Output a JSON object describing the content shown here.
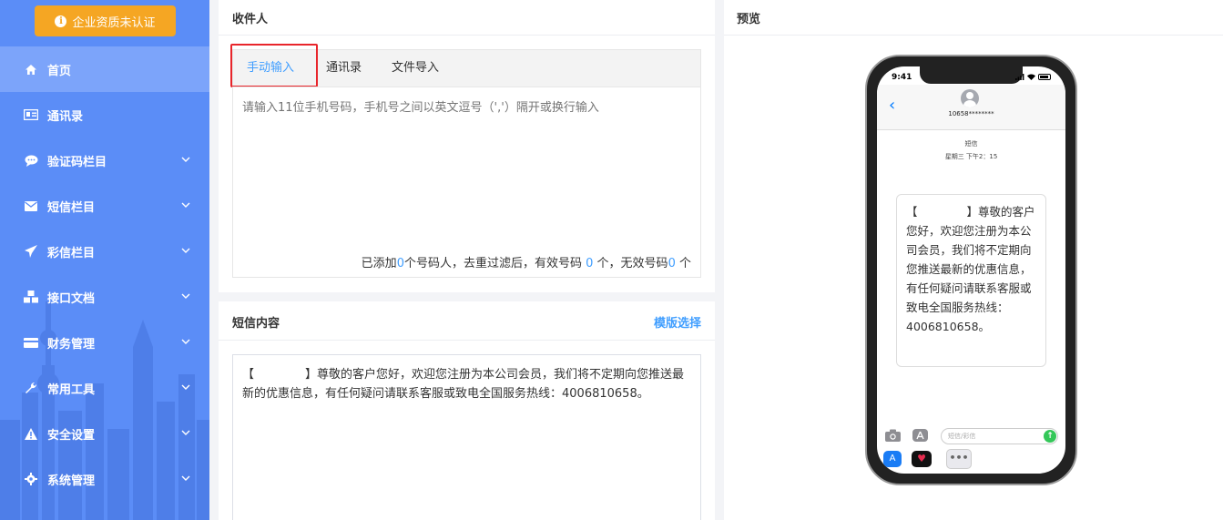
{
  "sidebar": {
    "cert_button_label": "企业资质未认证",
    "items": [
      {
        "label": "首页",
        "icon": "home-icon",
        "active": true
      },
      {
        "label": "通讯录",
        "icon": "contacts-icon"
      },
      {
        "label": "验证码栏目",
        "icon": "chat-bubble-icon"
      },
      {
        "label": "短信栏目",
        "icon": "envelope-icon"
      },
      {
        "label": "彩信栏目",
        "icon": "paper-plane-icon"
      },
      {
        "label": "接口文档",
        "icon": "cubes-icon"
      },
      {
        "label": "财务管理",
        "icon": "credit-card-icon"
      },
      {
        "label": "常用工具",
        "icon": "wrench-icon"
      },
      {
        "label": "安全设置",
        "icon": "warning-icon"
      },
      {
        "label": "系统管理",
        "icon": "gear-icon"
      }
    ]
  },
  "recipient": {
    "title": "收件人",
    "tabs": [
      {
        "label": "手动输入",
        "active": true
      },
      {
        "label": "通讯录"
      },
      {
        "label": "文件导入"
      }
    ],
    "placeholder": "请输入11位手机号码，手机号之间以英文逗号（','）隔开或换行输入",
    "stats": {
      "prefix": "已添加",
      "added": "0",
      "mid1": "个号码人，去重过滤后，有效号码",
      "valid": "0",
      "mid2": "个，无效号码",
      "invalid": "0",
      "suffix": "个"
    }
  },
  "sms": {
    "title": "短信内容",
    "template_link": "模版选择",
    "content_open": "【",
    "content_close": "】",
    "content_body": "尊敬的客户您好，欢迎您注册为本公司会员，我们将不定期向您推送最新的优惠信息，有任何疑问请联系客服或致电全国服务热线：4006810658。"
  },
  "preview": {
    "title": "预览",
    "phone": {
      "status_time": "9:41",
      "sender": "10658********",
      "msg_type": "短信",
      "msg_time": "星期三 下午2：15",
      "bubble_open": "【",
      "bubble_close": "】",
      "bubble_text": "尊敬的客户您好，欢迎您注册为本公司会员，我们将不定期向您推送最新的优惠信息，有任何疑问请联系客服或致电全国服务热线：4006810658。",
      "input_placeholder": "短信/彩信"
    }
  },
  "colors": {
    "sidebar_bg": "#5b8df7",
    "sidebar_active": "#7ca4fa",
    "cert_button": "#f5a623",
    "accent": "#409eff",
    "highlight": "#e8252b"
  }
}
